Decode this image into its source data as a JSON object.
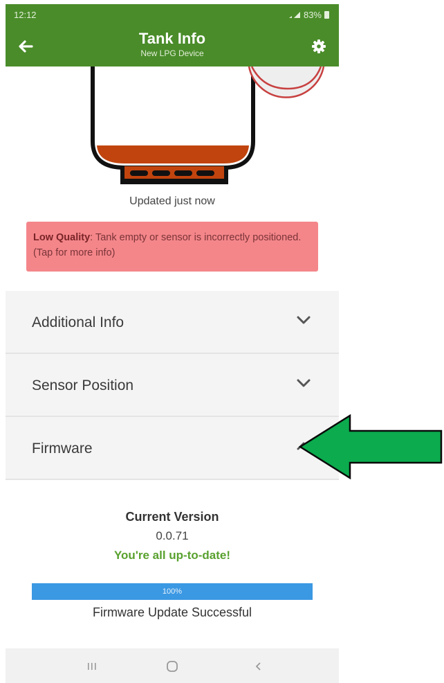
{
  "status_bar": {
    "time": "12:12",
    "battery": "83%"
  },
  "header": {
    "title": "Tank Info",
    "subtitle": "New LPG Device"
  },
  "tank": {
    "updated_text": "Updated just now",
    "fill_color": "#c1440e"
  },
  "alert": {
    "bold_label": "Low Quality",
    "message": ": Tank empty or sensor is incorrectly positioned. (Tap for more info)",
    "color": "#f4868a"
  },
  "accordion": [
    {
      "label": "Additional Info",
      "expanded": false
    },
    {
      "label": "Sensor Position",
      "expanded": false
    },
    {
      "label": "Firmware",
      "expanded": true
    }
  ],
  "firmware": {
    "heading": "Current Version",
    "version": "0.0.71",
    "status_message": "You're all up-to-date!",
    "progress_label": "100%",
    "progress": 1.0,
    "result": "Firmware Update Successful"
  },
  "colors": {
    "header": "#4a8c2a",
    "accent_green": "#58a12e",
    "progress_blue": "#3b98e3",
    "arrow": "#0bab4e"
  }
}
